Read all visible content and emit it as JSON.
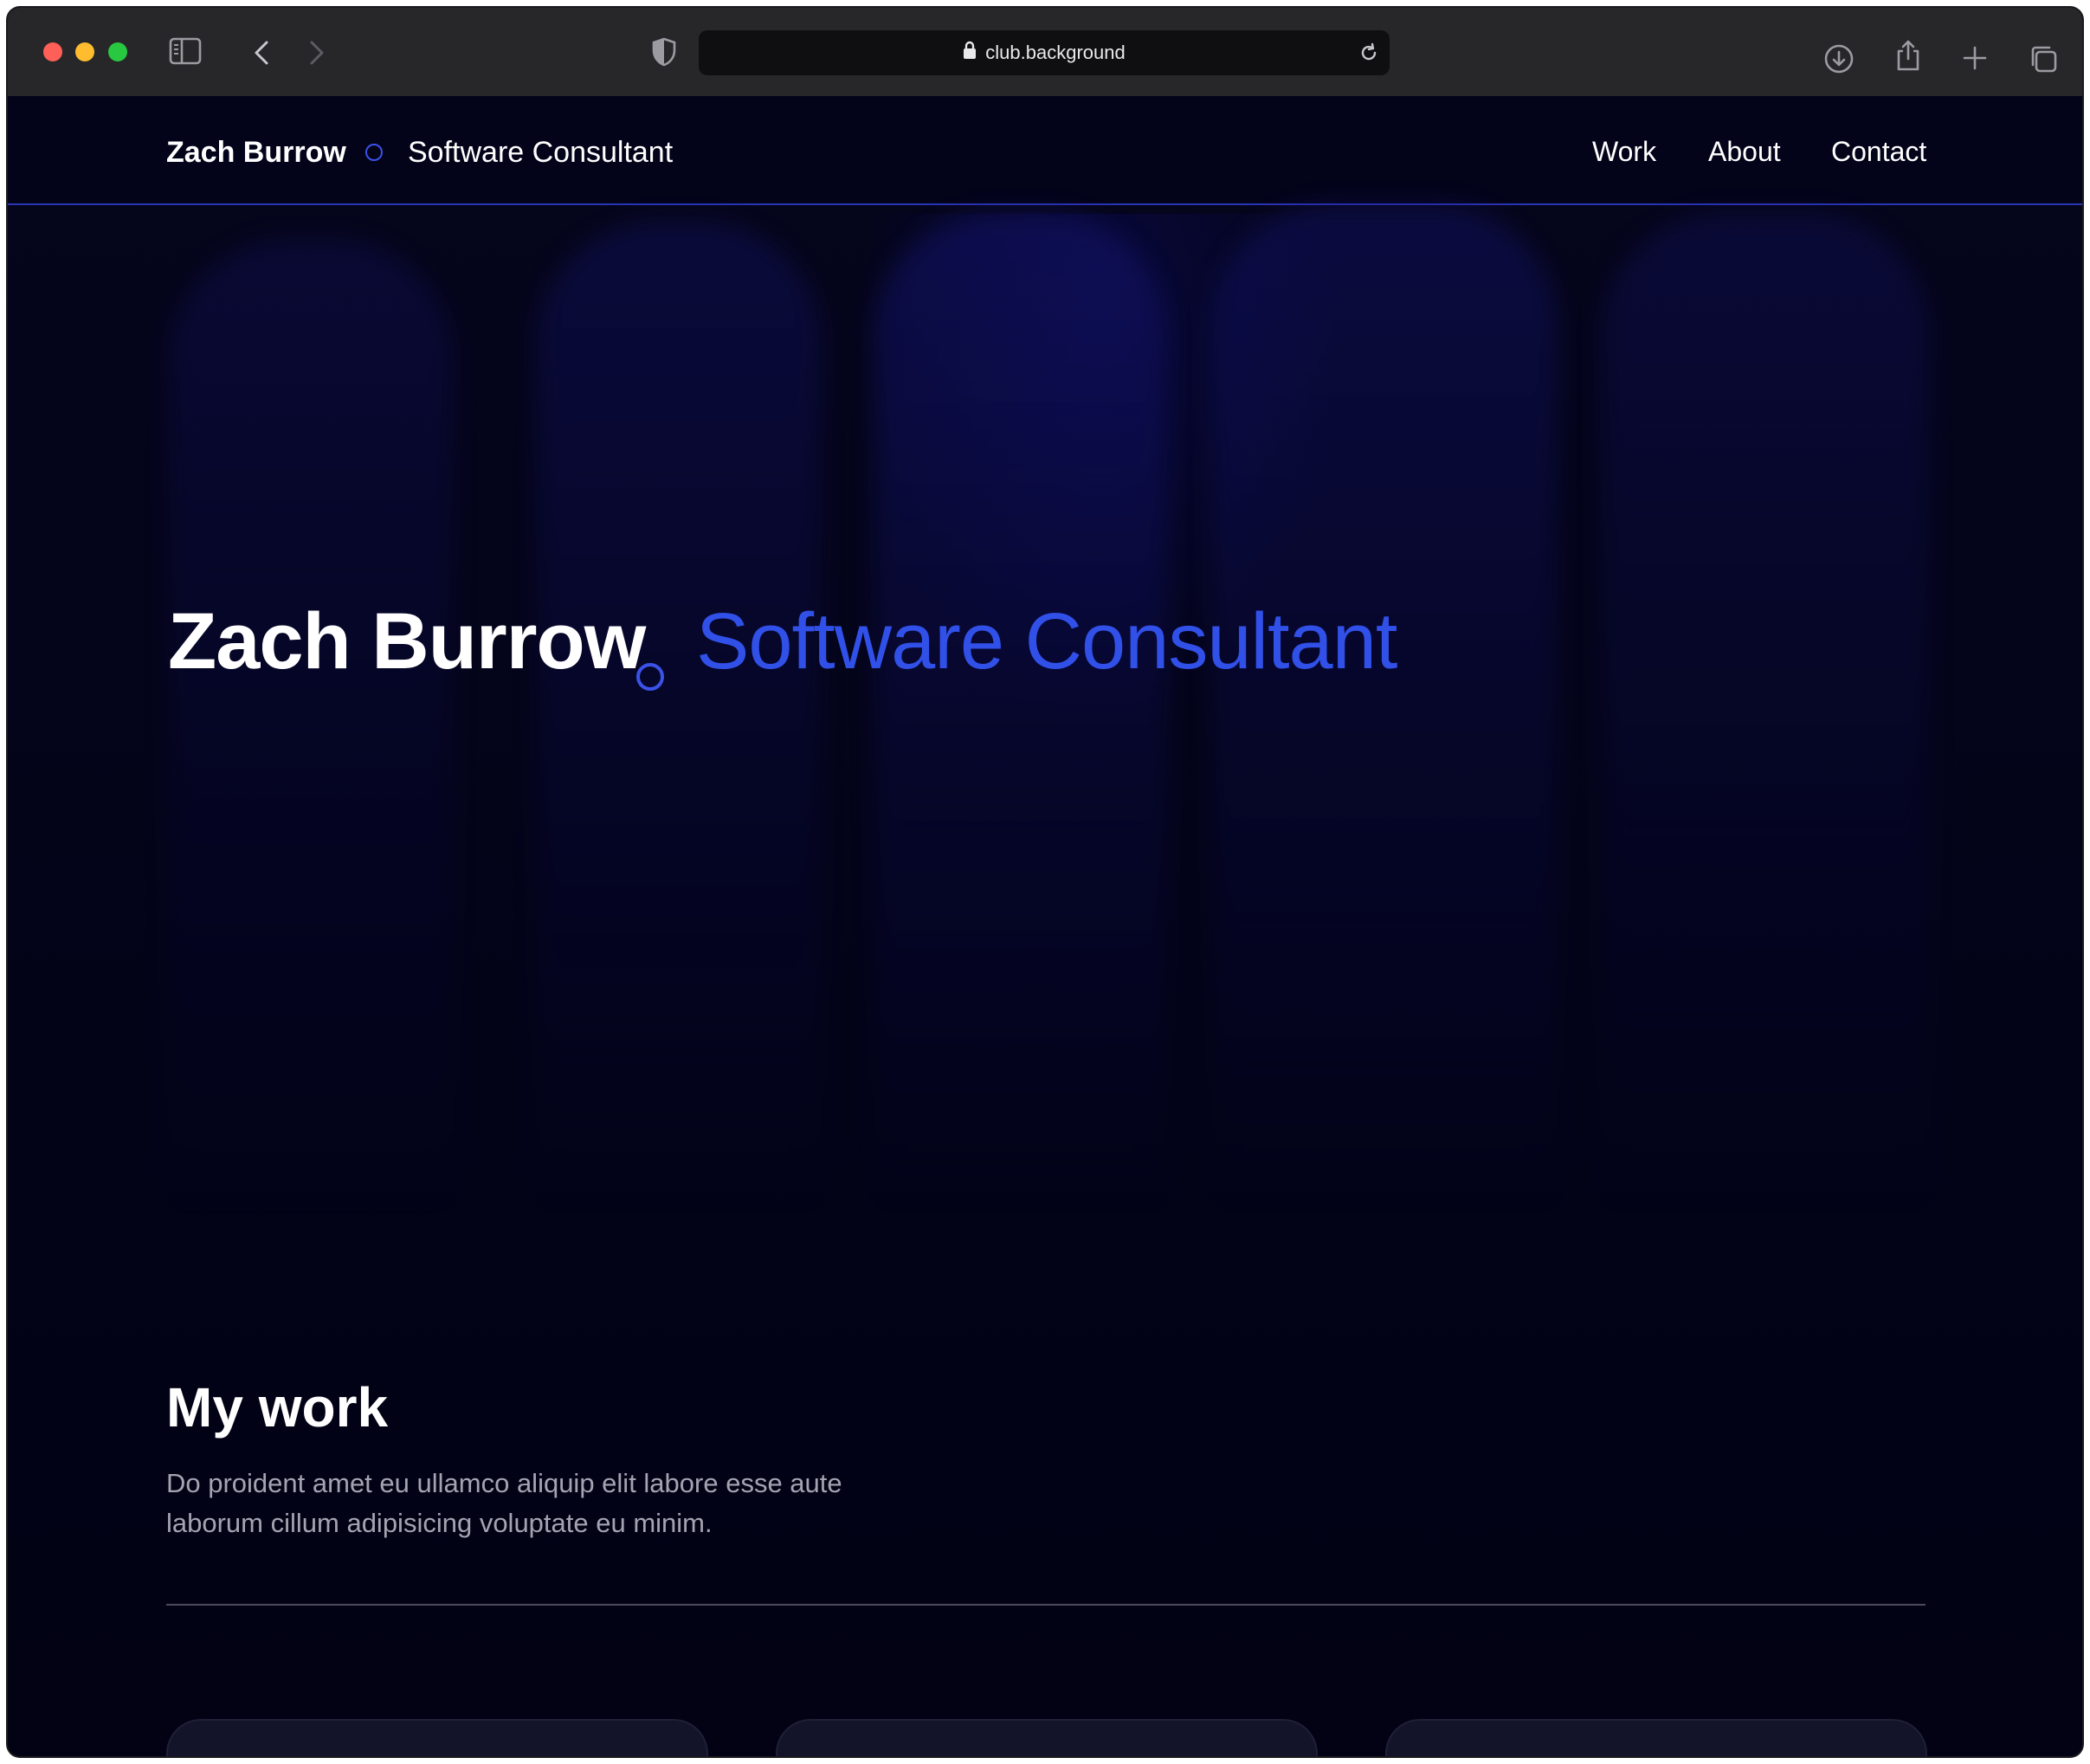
{
  "browser": {
    "url": "club.background",
    "icons": [
      "sidebar-icon",
      "back-icon",
      "forward-icon",
      "shield-icon",
      "lock-icon",
      "reload-icon",
      "download-icon",
      "share-icon",
      "new-tab-icon",
      "tabs-overview-icon"
    ]
  },
  "header": {
    "name": "Zach Burrow",
    "role": "Software Consultant",
    "nav": {
      "work": "Work",
      "about": "About",
      "contact": "Contact"
    }
  },
  "hero": {
    "name": "Zach Burrow",
    "role": "Software Consultant"
  },
  "work": {
    "title": "My work",
    "description_line1": "Do proident amet eu ullamco aliquip elit labore esse aute",
    "description_line2": "laborum cillum adipisicing voluptate eu minim."
  },
  "colors": {
    "accent": "#3050e8",
    "background": "#03031a",
    "card": "#13132a"
  }
}
